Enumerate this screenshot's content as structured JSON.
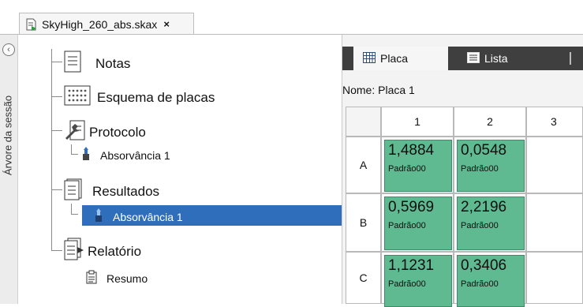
{
  "document_tab": {
    "title": "SkyHigh_260_abs.skax",
    "close_glyph": "×"
  },
  "sidebar": {
    "collapse_glyph": "‹",
    "label": "Árvore da sessão"
  },
  "tree": {
    "items": [
      {
        "label": "Notas",
        "icon": "notes-icon"
      },
      {
        "label": "Esquema de placas",
        "icon": "plate-layout-icon"
      },
      {
        "label": "Protocolo",
        "icon": "protocol-wrench-icon"
      },
      {
        "label": "Absorvância 1",
        "icon": "absorbance-icon"
      },
      {
        "label": "Resultados",
        "icon": "results-icon"
      },
      {
        "label": "Absorvância 1",
        "icon": "absorbance-icon",
        "selected": true
      },
      {
        "label": "Relatório",
        "icon": "report-icon"
      },
      {
        "label": "Resumo",
        "icon": "summary-icon"
      }
    ],
    "selection_color": "#2f6eba"
  },
  "view": {
    "tabs": [
      {
        "label": "Placa",
        "icon": "grid-icon",
        "active": true
      },
      {
        "label": "Lista",
        "icon": "list-icon",
        "active": false
      }
    ],
    "name_label": "Nome:",
    "name_value": "Placa 1"
  },
  "plate": {
    "columns": [
      "1",
      "2",
      "3"
    ],
    "rows": [
      {
        "label": "A",
        "wells": [
          {
            "value": "1,4884",
            "label": "Padrão00"
          },
          {
            "value": "0,0548",
            "label": "Padrão00"
          }
        ]
      },
      {
        "label": "B",
        "wells": [
          {
            "value": "0,5969",
            "label": "Padrão00"
          },
          {
            "value": "2,2196",
            "label": "Padrão00"
          }
        ]
      },
      {
        "label": "C",
        "wells": [
          {
            "value": "1,1231",
            "label": "Padrão00"
          },
          {
            "value": "0,3406",
            "label": "Padrão00"
          }
        ]
      }
    ],
    "well_color": "#5fb991"
  }
}
